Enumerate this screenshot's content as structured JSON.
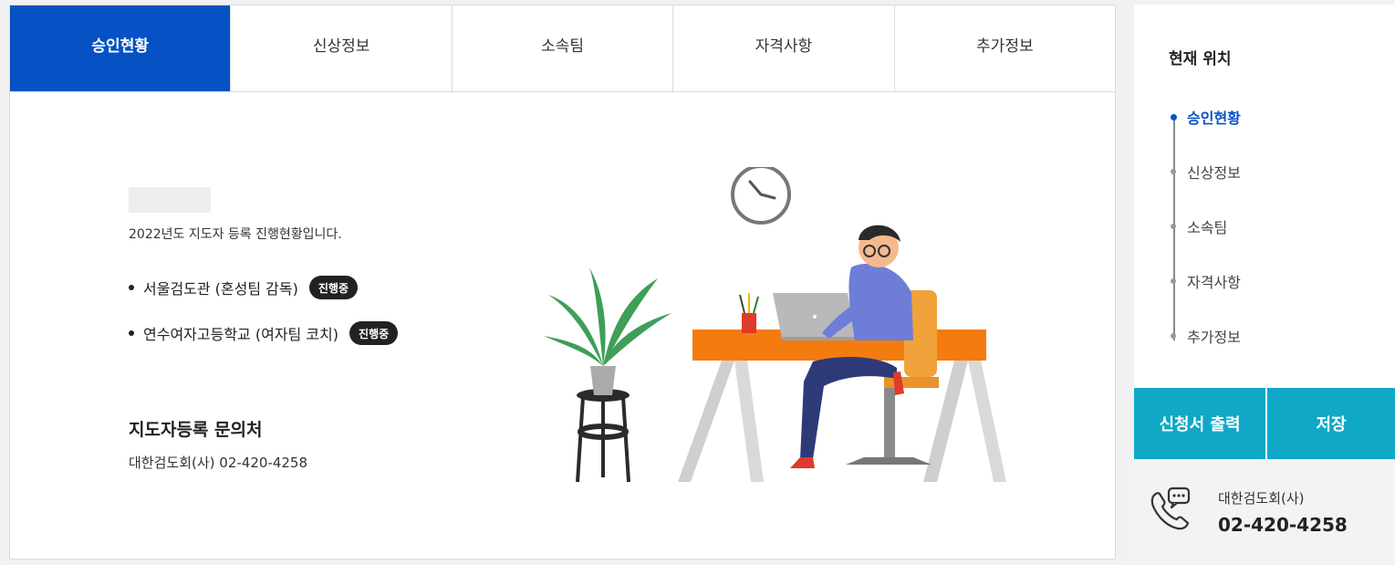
{
  "tabs": [
    {
      "label": "승인현황",
      "active": true
    },
    {
      "label": "신상정보",
      "active": false
    },
    {
      "label": "소속팀",
      "active": false
    },
    {
      "label": "자격사항",
      "active": false
    },
    {
      "label": "추가정보",
      "active": false
    }
  ],
  "content": {
    "intro": "2022년도 지도자 등록 진행현황입니다.",
    "items": [
      {
        "text": "서울검도관 (혼성팀 감독)",
        "badge": "진행중"
      },
      {
        "text": "연수여자고등학교 (여자팀 코치)",
        "badge": "진행중"
      }
    ],
    "contact_title": "지도자등록 문의처",
    "contact_text": "대한검도회(사) 02-420-4258"
  },
  "sidebar": {
    "location_title": "현재 위치",
    "location_items": [
      {
        "label": "승인현황",
        "active": true
      },
      {
        "label": "신상정보",
        "active": false
      },
      {
        "label": "소속팀",
        "active": false
      },
      {
        "label": "자격사항",
        "active": false
      },
      {
        "label": "추가정보",
        "active": false
      }
    ],
    "print_button": "신청서 출력",
    "save_button": "저장",
    "contact_org": "대한검도회(사)",
    "contact_phone": "02-420-4258"
  },
  "colors": {
    "primary": "#0652c5",
    "action": "#0fa8c6",
    "badge": "#222222",
    "desk": "#f47b10"
  },
  "icons": [
    "clock-icon",
    "phone-chat-icon"
  ]
}
